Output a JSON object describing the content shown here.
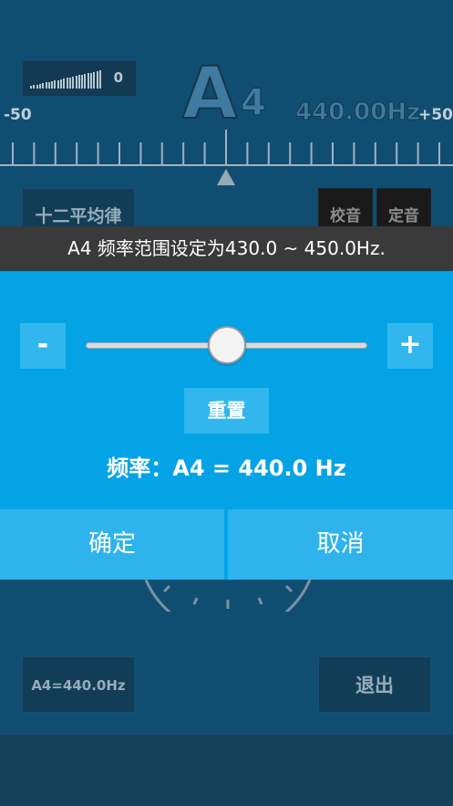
{
  "tuner": {
    "volume_value": "0",
    "note": "A",
    "octave": "4",
    "frequency": "440.00Hz",
    "scale_min": "-50",
    "scale_max": "+50",
    "temperament_button": "十二平均律",
    "calibrate_button": "校音",
    "set_tone_button": "定音",
    "a4_reference_button": "A4=440.0Hz",
    "exit_button": "退出"
  },
  "dialog": {
    "range_message": "A4 频率范围设定为430.0 ~ 450.0Hz.",
    "decrease_label": "-",
    "increase_label": "+",
    "slider_position": 0.5,
    "reset_label": "重置",
    "frequency_text": "频率：A4 = 440.0 Hz",
    "confirm_label": "确定",
    "cancel_label": "取消"
  },
  "colors": {
    "screen_background": "#0f4e71",
    "dialog_background": "#03a3e6",
    "dialog_button": "#31b6ee",
    "toast_background": "#3a3a3a"
  }
}
